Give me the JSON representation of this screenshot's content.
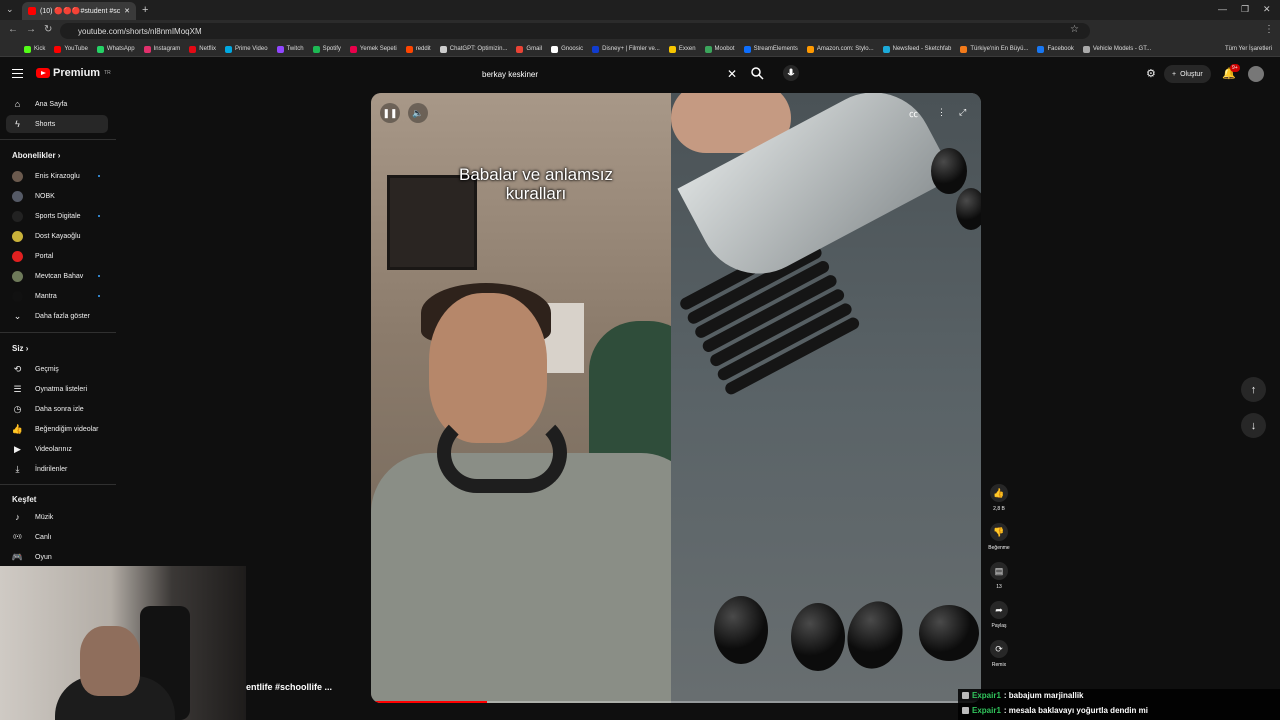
{
  "browser": {
    "tab_title": "(10) 🔴🔴🔴#student #sc",
    "url": "youtube.com/shorts/nl8nmIMoqXM",
    "bookmarks": [
      {
        "label": "Kick",
        "color": "#53fc18"
      },
      {
        "label": "YouTube",
        "color": "#ff0000"
      },
      {
        "label": "WhatsApp",
        "color": "#25d366"
      },
      {
        "label": "Instagram",
        "color": "#e1306c"
      },
      {
        "label": "Netflix",
        "color": "#e50914"
      },
      {
        "label": "Prime Video",
        "color": "#00a8e1"
      },
      {
        "label": "Twitch",
        "color": "#9146ff"
      },
      {
        "label": "Spotify",
        "color": "#1db954"
      },
      {
        "label": "Yemek Sepeti",
        "color": "#ea004b"
      },
      {
        "label": "reddit",
        "color": "#ff4500"
      },
      {
        "label": "ChatGPT: Optimizin...",
        "color": "#cccccc"
      },
      {
        "label": "Gmail",
        "color": "#ea4335"
      },
      {
        "label": "Gnoosic",
        "color": "#ffffff"
      },
      {
        "label": "Disney+ | Filmler ve...",
        "color": "#113ccf"
      },
      {
        "label": "Exxen",
        "color": "#f7c600"
      },
      {
        "label": "Moobot",
        "color": "#3ba55c"
      },
      {
        "label": "StreamElements",
        "color": "#0d6efd"
      },
      {
        "label": "Amazon.com: Stylo...",
        "color": "#ff9900"
      },
      {
        "label": "Newsfeed - Sketchfab",
        "color": "#1caad9"
      },
      {
        "label": "Türkiye'nin En Büyü...",
        "color": "#f27a1a"
      },
      {
        "label": "Facebook",
        "color": "#1877f2"
      },
      {
        "label": "Vehicle Models - GT...",
        "color": "#aaaaaa"
      }
    ],
    "all_bookmarks": "Tüm Yer İşaretleri"
  },
  "header": {
    "logo_text": "Premium",
    "logo_region": "TR",
    "search_value": "berkay keskiner",
    "create_label": "Oluştur",
    "notif_count": "9+"
  },
  "sidebar": {
    "home": "Ana Sayfa",
    "shorts": "Shorts",
    "subs_heading": "Abonelikler",
    "channels": [
      {
        "name": "Enis Kirazoglu",
        "color": "#6b5a4e"
      },
      {
        "name": "NOBK",
        "color": "#555a66"
      },
      {
        "name": "Sports Digitale",
        "color": "#222222"
      },
      {
        "name": "Dost Kayaoğlu",
        "color": "#c9b23a"
      },
      {
        "name": "Portal",
        "color": "#e02020"
      },
      {
        "name": "Mevtcan Bahav",
        "color": "#6e7a5a"
      },
      {
        "name": "Mantra",
        "color": "#111111"
      }
    ],
    "show_more": "Daha fazla göster",
    "you_heading": "Siz",
    "you_items": [
      "Geçmiş",
      "Oynatma listeleri",
      "Daha sonra izle",
      "Beğendiğim videolar",
      "Videolarınız",
      "İndirilenler"
    ],
    "explore_heading": "Keşfet",
    "explore_items": [
      "Müzik",
      "Canlı",
      "Oyun"
    ]
  },
  "video": {
    "caption_line1": "Babalar ve anlamsız",
    "caption_line2": "kuralları",
    "progress": 0.19
  },
  "actions": {
    "like_count": "2,8 B",
    "dislike_label": "Beğenme",
    "comment_count": "13",
    "share_label": "Paylaş",
    "remix_label": "Remix"
  },
  "bottom_title": "entlife #schoollife ...",
  "chat": [
    {
      "user": "Expair1",
      "message": ": babajum marjinallik"
    },
    {
      "user": "Expair1",
      "message": ": mesala baklavayı yoğurtla dendin mi"
    }
  ]
}
